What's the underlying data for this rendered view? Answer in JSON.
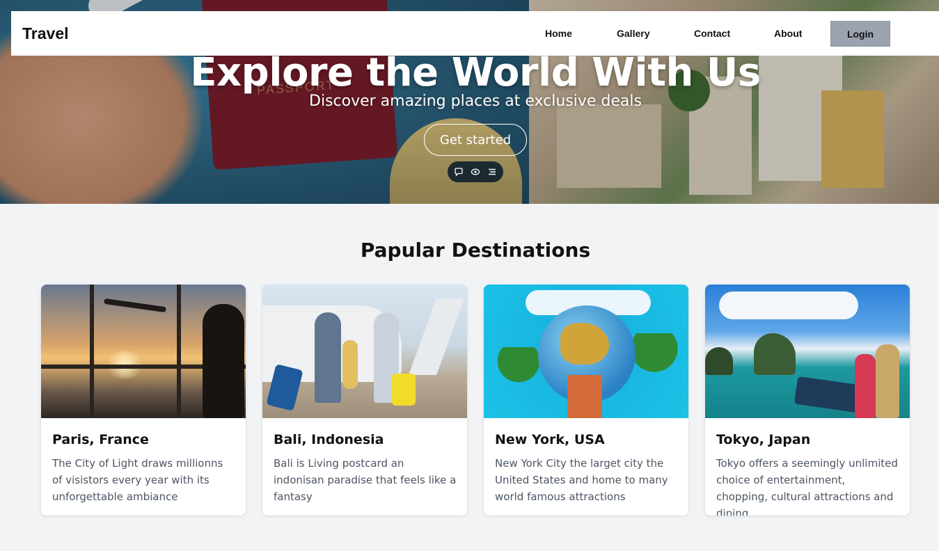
{
  "nav": {
    "brand": "Travel",
    "links": [
      "Home",
      "Gallery",
      "Contact",
      "About"
    ],
    "login_label": "Login"
  },
  "hero": {
    "title": "Explore the World With Us",
    "subtitle": "Discover amazing places at exclusive deals",
    "cta_label": "Get started",
    "passport_text": "PASSPORT",
    "tools": [
      "comment-icon",
      "eye-icon",
      "list-icon"
    ]
  },
  "section": {
    "title": "Papular Destinations"
  },
  "destinations": [
    {
      "name": "Paris, France",
      "description": "The City of Light draws millionns of visistors every year with its unforgettable ambiance"
    },
    {
      "name": "Bali, Indonesia",
      "description": "Bali is Living postcard an indonisan paradise that feels like a fantasy"
    },
    {
      "name": "New York, USA",
      "description": "New York City the larget city the United States and home to many world famous attractions"
    },
    {
      "name": "Tokyo, Japan",
      "description": "Tokyo offers a seemingly unlimited choice of entertainment, chopping, cultural attractions and dining"
    }
  ],
  "colors": {
    "page_bg": "#f2f3f5",
    "login_bg": "#9aa3af",
    "text_dark": "#111111",
    "text_muted": "#4b5563"
  }
}
